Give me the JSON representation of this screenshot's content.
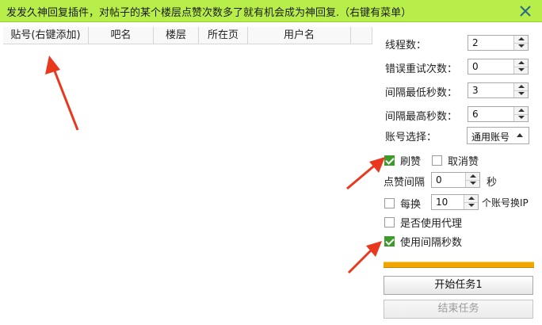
{
  "window": {
    "title": "发发久神回复插件，对帖子的某个楼层点赞次数多了就有机会成为神回复.（右键有菜单）"
  },
  "grid": {
    "columns": [
      {
        "label": "贴号(右键添加)"
      },
      {
        "label": "吧名"
      },
      {
        "label": "楼层"
      },
      {
        "label": "所在页"
      },
      {
        "label": "用户名"
      },
      {
        "label": ""
      }
    ]
  },
  "settings": {
    "threads": {
      "label": "线程数：",
      "value": "2"
    },
    "retries": {
      "label": "错误重试次数：",
      "value": "0"
    },
    "min_interval": {
      "label": "间隔最低秒数：",
      "value": "3"
    },
    "max_interval": {
      "label": "间隔最高秒数：",
      "value": "6"
    },
    "account": {
      "label": "账号选择：",
      "value": "通用账号"
    },
    "like": {
      "label": "刷赞",
      "checked": true
    },
    "unlike": {
      "label": "取消赞",
      "checked": false
    },
    "like_interval": {
      "label": "点赞间隔",
      "value": "0",
      "unit": "秒"
    },
    "switch_ip": {
      "prefix": "每换",
      "value": "10",
      "suffix": "个账号换IP",
      "checked": false
    },
    "proxy": {
      "label": "是否使用代理",
      "checked": false
    },
    "use_interval": {
      "label": "使用间隔秒数",
      "checked": true
    }
  },
  "progress": {
    "fraction": 1.0,
    "color": "#f1a500"
  },
  "buttons": {
    "start": "开始任务1",
    "stop": "结束任务"
  },
  "colors": {
    "titlebar": "#b8ee4a",
    "annotation_arrow": "#e8391e",
    "check": "#3f9a2c"
  }
}
